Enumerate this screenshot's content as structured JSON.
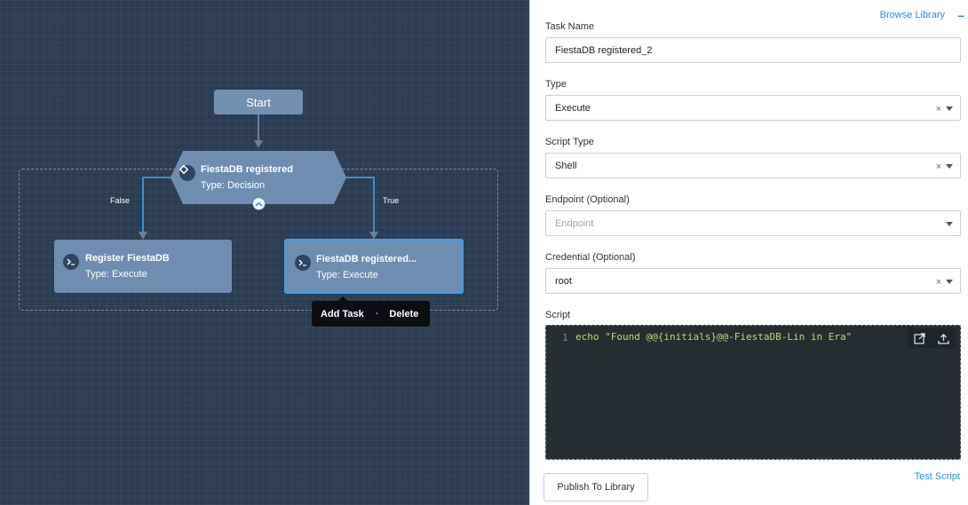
{
  "canvas": {
    "start_label": "Start",
    "decision": {
      "title": "FiestaDB registered",
      "type": "Type: Decision"
    },
    "false_label": "False",
    "true_label": "True",
    "task_left": {
      "title": "Register FiestaDB",
      "type": "Type: Execute"
    },
    "task_right": {
      "title": "FiestaDB registered...",
      "type": "Type: Execute"
    },
    "context_menu": {
      "add_task": "Add Task",
      "separator": "·",
      "delete": "Delete"
    }
  },
  "panel": {
    "browse_library": "Browse Library",
    "collapse_symbol": "–",
    "task_name": {
      "label": "Task Name",
      "value": "FiestaDB registered_2"
    },
    "type": {
      "label": "Type",
      "value": "Execute"
    },
    "script_type": {
      "label": "Script Type",
      "value": "Shell"
    },
    "endpoint": {
      "label": "Endpoint (Optional)",
      "placeholder": "Endpoint"
    },
    "credential": {
      "label": "Credential (Optional)",
      "value": "root"
    },
    "script": {
      "label": "Script",
      "line_number": "1",
      "code": "echo \"Found @@{initials}@@-FiestaDB-Lin in Era\""
    },
    "test_script": "Test Script",
    "publish_button": "Publish To Library",
    "clear_symbol": "×"
  },
  "colors": {
    "canvas_bg": "#2b3d52",
    "node_fill": "#6f8db0",
    "accent_blue": "#2a8bd8",
    "connector": "#3d8fc9"
  }
}
